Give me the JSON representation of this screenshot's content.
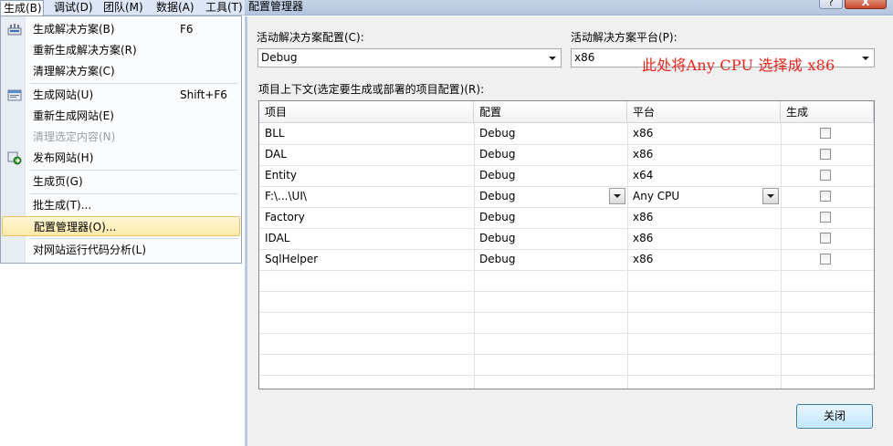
{
  "menubar": {
    "items": [
      {
        "label": "生成(B)"
      },
      {
        "label": "调试(D)"
      },
      {
        "label": "团队(M)"
      },
      {
        "label": "数据(A)"
      },
      {
        "label": "工具(T)"
      }
    ]
  },
  "build_menu": {
    "items": [
      {
        "label": "生成解决方案(B)",
        "shortcut": "F6",
        "icon": "build-solution-icon"
      },
      {
        "label": "重新生成解决方案(R)"
      },
      {
        "label": "清理解决方案(C)"
      },
      {
        "label": "生成网站(U)",
        "shortcut": "Shift+F6",
        "icon": "build-website-icon"
      },
      {
        "label": "重新生成网站(E)"
      },
      {
        "label": "清理选定内容(N)",
        "disabled": true
      },
      {
        "label": "发布网站(H)",
        "icon": "publish-website-icon"
      },
      {
        "label": "生成页(G)"
      },
      {
        "label": "批生成(T)..."
      },
      {
        "label": "配置管理器(O)...",
        "highlighted": true
      },
      {
        "label": "对网站运行代码分析(L)"
      }
    ]
  },
  "dialog": {
    "title": "配置管理器",
    "active_config_label": "活动解决方案配置(C):",
    "active_config_value": "Debug",
    "active_platform_label": "活动解决方案平台(P):",
    "active_platform_value": "x86",
    "annotation": "此处将Any CPU 选择成 x86",
    "context_label": "项目上下文(选定要生成或部署的项目配置)(R):",
    "close_button": "关闭",
    "help_button": "?",
    "close_x": "X",
    "columns": [
      "项目",
      "配置",
      "平台",
      "生成"
    ],
    "rows": [
      {
        "project": "BLL",
        "config": "Debug",
        "platform": "x86",
        "build": false
      },
      {
        "project": "DAL",
        "config": "Debug",
        "platform": "x86",
        "build": false
      },
      {
        "project": "Entity",
        "config": "Debug",
        "platform": "x64",
        "build": false
      },
      {
        "project": "F:\\...\\UI\\",
        "config": "Debug",
        "platform": "Any CPU",
        "build": false,
        "selected": true
      },
      {
        "project": "Factory",
        "config": "Debug",
        "platform": "x86",
        "build": false
      },
      {
        "project": "IDAL",
        "config": "Debug",
        "platform": "x86",
        "build": false
      },
      {
        "project": "SqlHelper",
        "config": "Debug",
        "platform": "x86",
        "build": false
      }
    ]
  }
}
